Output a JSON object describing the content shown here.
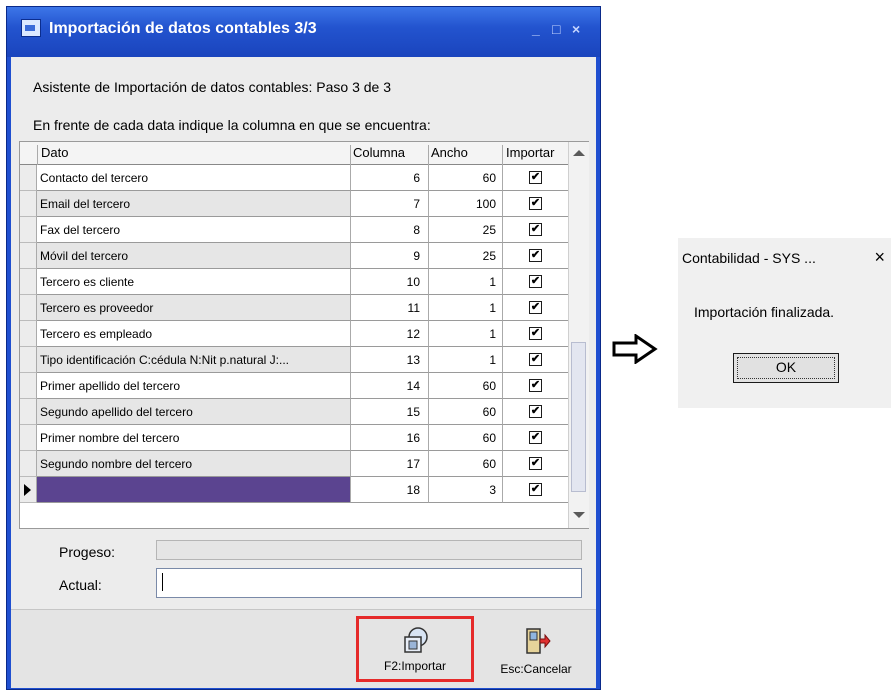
{
  "window": {
    "title": "Importación de datos contables 3/3",
    "controls": {
      "minimize": "_",
      "maximize": "□",
      "close": "×"
    }
  },
  "wizard": {
    "step_text": "Asistente de Importación de datos contables: Paso 3 de 3",
    "instruction": "En frente de cada data indique la columna en que se encuentra:"
  },
  "grid": {
    "headers": {
      "dato": "Dato",
      "columna": "Columna",
      "ancho": "Ancho",
      "importar": "Importar"
    },
    "rows": [
      {
        "dato": "Contacto del tercero",
        "columna": "6",
        "ancho": "60",
        "importar": true
      },
      {
        "dato": "Email del tercero",
        "columna": "7",
        "ancho": "100",
        "importar": true
      },
      {
        "dato": "Fax del tercero",
        "columna": "8",
        "ancho": "25",
        "importar": true
      },
      {
        "dato": "Móvil del tercero",
        "columna": "9",
        "ancho": "25",
        "importar": true
      },
      {
        "dato": "Tercero es cliente",
        "columna": "10",
        "ancho": "1",
        "importar": true
      },
      {
        "dato": "Tercero es proveedor",
        "columna": "11",
        "ancho": "1",
        "importar": true
      },
      {
        "dato": "Tercero es empleado",
        "columna": "12",
        "ancho": "1",
        "importar": true
      },
      {
        "dato": "Tipo identificación C:cédula N:Nit p.natural J:...",
        "columna": "13",
        "ancho": "1",
        "importar": true
      },
      {
        "dato": "Primer apellido del tercero",
        "columna": "14",
        "ancho": "60",
        "importar": true
      },
      {
        "dato": "Segundo apellido del tercero",
        "columna": "15",
        "ancho": "60",
        "importar": true
      },
      {
        "dato": "Primer nombre del tercero",
        "columna": "16",
        "ancho": "60",
        "importar": true
      },
      {
        "dato": "Segundo nombre del tercero",
        "columna": "17",
        "ancho": "60",
        "importar": true
      },
      {
        "dato": "",
        "columna": "18",
        "ancho": "3",
        "importar": true
      }
    ]
  },
  "progress": {
    "label": "Progeso:",
    "value": 0
  },
  "actual": {
    "label": "Actual:",
    "value": ""
  },
  "buttons": {
    "import": "F2:Importar",
    "cancel": "Esc:Cancelar"
  },
  "dialog": {
    "title": "Contabilidad - SYS ...",
    "close": "×",
    "message": "Importación finalizada.",
    "ok": "OK"
  },
  "icons": {
    "arrow": "right-arrow-icon",
    "import": "import-icon",
    "cancel": "exit-door-icon"
  },
  "colors": {
    "title_bar": "#2354cf",
    "selected_row": "#5b4490",
    "highlight_border": "#e52a2a"
  }
}
